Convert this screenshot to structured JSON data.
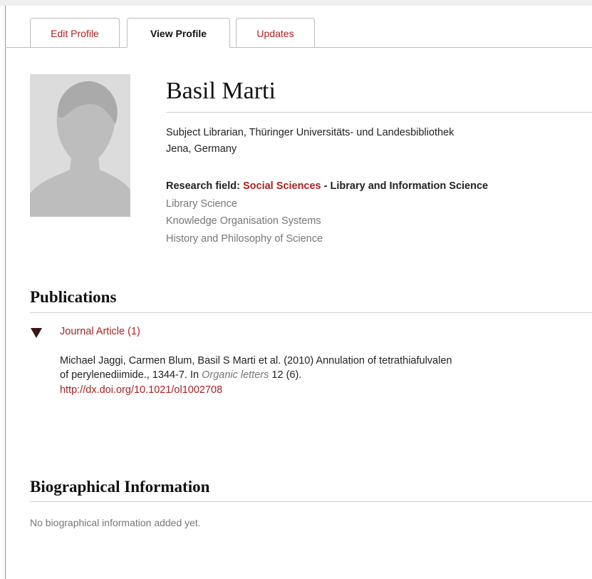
{
  "tabs": [
    {
      "label": "Edit Profile"
    },
    {
      "label": "View Profile"
    },
    {
      "label": "Updates"
    }
  ],
  "profile": {
    "name": "Basil Marti",
    "position": "Subject Librarian, Thüringer Universitäts- und Landesbibliothek",
    "location": "Jena, Germany",
    "research_label": "Research field: ",
    "research_field": "Social Sciences",
    "research_sub": " - Library and Information Science",
    "interests": [
      "Library Science",
      "Knowledge Organisation Systems",
      "History and Philosophy of Science"
    ]
  },
  "publications": {
    "title": "Publications",
    "toggle": "Journal Article (1)",
    "line1": "Michael Jaggi, Carmen Blum, Basil S Marti et al. (2010) Annulation of tetrathiafulvalen",
    "line2_pre": "of perylenediimide., 1344-7. In ",
    "journal": "Organic letters",
    "volume": " 12 (6).",
    "doi": "http://dx.doi.org/10.1021/ol1002708"
  },
  "bio": {
    "title": "Biographical Information",
    "text": "No biographical information added yet."
  },
  "colors": {
    "accent": "#b01f1f",
    "muted": "#777777"
  }
}
